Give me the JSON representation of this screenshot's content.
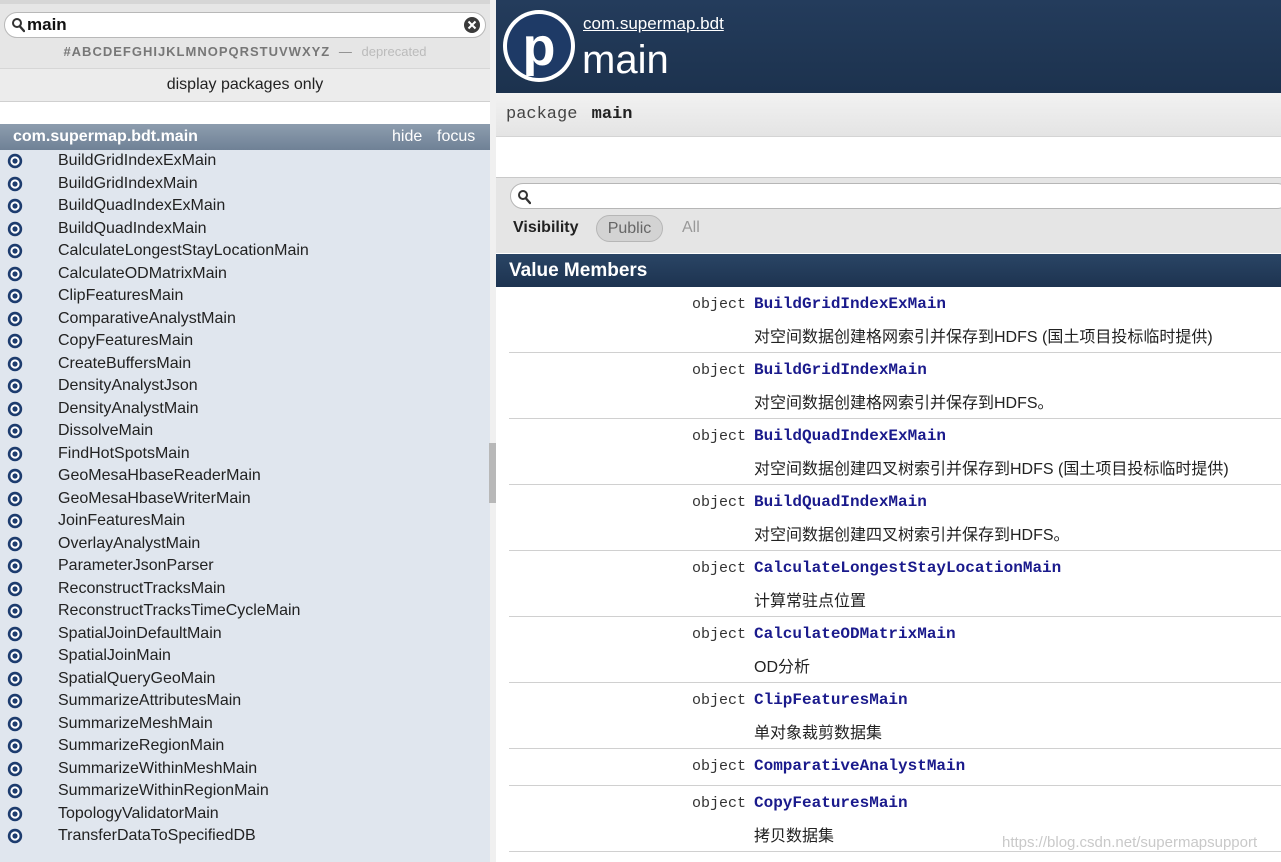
{
  "left": {
    "search": {
      "value": "main"
    },
    "letters": "#ABCDEFGHIJKLMNOPQRSTUVWXYZ",
    "dash": "—",
    "deprecated": "deprecated",
    "display_packages": "display packages only",
    "package": {
      "name": "com.supermap.bdt.main",
      "hide": "hide",
      "focus": "focus"
    },
    "items": [
      "BuildGridIndexExMain",
      "BuildGridIndexMain",
      "BuildQuadIndexExMain",
      "BuildQuadIndexMain",
      "CalculateLongestStayLocationMain",
      "CalculateODMatrixMain",
      "ClipFeaturesMain",
      "ComparativeAnalystMain",
      "CopyFeaturesMain",
      "CreateBuffersMain",
      "DensityAnalystJson",
      "DensityAnalystMain",
      "DissolveMain",
      "FindHotSpotsMain",
      "GeoMesaHbaseReaderMain",
      "GeoMesaHbaseWriterMain",
      "JoinFeaturesMain",
      "OverlayAnalystMain",
      "ParameterJsonParser",
      "ReconstructTracksMain",
      "ReconstructTracksTimeCycleMain",
      "SpatialJoinDefaultMain",
      "SpatialJoinMain",
      "SpatialQueryGeoMain",
      "SummarizeAttributesMain",
      "SummarizeMeshMain",
      "SummarizeRegionMain",
      "SummarizeWithinMeshMain",
      "SummarizeWithinRegionMain",
      "TopologyValidatorMain",
      "TransferDataToSpecifiedDB"
    ]
  },
  "right": {
    "owner": "com.supermap.bdt",
    "title": "main",
    "signature": {
      "keyword": "package",
      "name": "main"
    },
    "visibility": {
      "label": "Visibility",
      "public": "Public",
      "all": "All"
    },
    "value_members_header": "Value Members",
    "members": [
      {
        "kind": "object",
        "name": "BuildGridIndexExMain",
        "desc": "对空间数据创建格网索引并保存到HDFS (国土项目投标临时提供)"
      },
      {
        "kind": "object",
        "name": "BuildGridIndexMain",
        "desc": "对空间数据创建格网索引并保存到HDFS。"
      },
      {
        "kind": "object",
        "name": "BuildQuadIndexExMain",
        "desc": "对空间数据创建四叉树索引并保存到HDFS (国土项目投标临时提供)"
      },
      {
        "kind": "object",
        "name": "BuildQuadIndexMain",
        "desc": "对空间数据创建四叉树索引并保存到HDFS。"
      },
      {
        "kind": "object",
        "name": "CalculateLongestStayLocationMain",
        "desc": "计算常驻点位置"
      },
      {
        "kind": "object",
        "name": "CalculateODMatrixMain",
        "desc": "OD分析"
      },
      {
        "kind": "object",
        "name": "ClipFeaturesMain",
        "desc": "单对象裁剪数据集"
      },
      {
        "kind": "object",
        "name": "ComparativeAnalystMain",
        "desc": ""
      },
      {
        "kind": "object",
        "name": "CopyFeaturesMain",
        "desc": "拷贝数据集"
      }
    ]
  },
  "watermark": "https://blog.csdn.net/supermapsupport",
  "colors": {
    "header_bg": "#1f3654",
    "package_bar": "#7c8ea3",
    "list_bg": "#e0e6ee",
    "member_link": "#1a1a8c",
    "object_icon": "#1d3c6e"
  }
}
